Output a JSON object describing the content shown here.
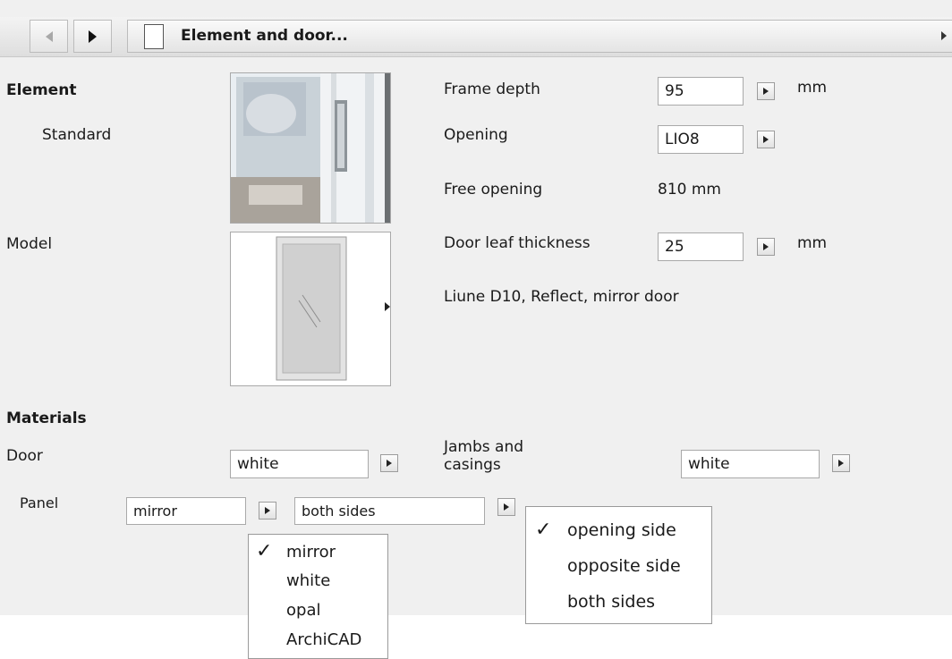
{
  "titlebar": {
    "title": "Element and door..."
  },
  "element": {
    "section_label": "Element",
    "type_value": "Standard",
    "model_label": "Model"
  },
  "properties": {
    "frame_depth": {
      "label": "Frame depth",
      "value": "95",
      "unit": "mm"
    },
    "opening": {
      "label": "Opening",
      "value": "LIO8"
    },
    "free_opening": {
      "label": "Free opening",
      "value": "810 mm"
    },
    "door_leaf_thickness": {
      "label": "Door leaf thickness",
      "value": "25",
      "unit": "mm"
    },
    "model_description": "Liune D10, Reflect, mirror door"
  },
  "materials": {
    "section_label": "Materials",
    "door": {
      "label": "Door",
      "value": "white"
    },
    "jambs": {
      "label_line1": "Jambs and",
      "label_line2": "casings",
      "value": "white"
    },
    "panel": {
      "label": "Panel",
      "material_value": "mirror",
      "side_value": "both sides"
    }
  },
  "panel_material_menu": {
    "items": [
      "mirror",
      "white",
      "opal",
      "ArchiCAD"
    ],
    "checked_index": 0,
    "check_glyph": "✓"
  },
  "side_menu": {
    "items": [
      "opening side",
      "opposite side",
      "both sides"
    ],
    "checked_index": 0,
    "check_glyph": "✓"
  },
  "colors": {
    "panel_bg": "#f0f0f0",
    "menu_bg": "#ffffff",
    "border": "#a9a9a9"
  },
  "icons": [
    "back-arrow-icon",
    "forward-arrow-icon",
    "document-icon",
    "expand-arrow-icon"
  ]
}
